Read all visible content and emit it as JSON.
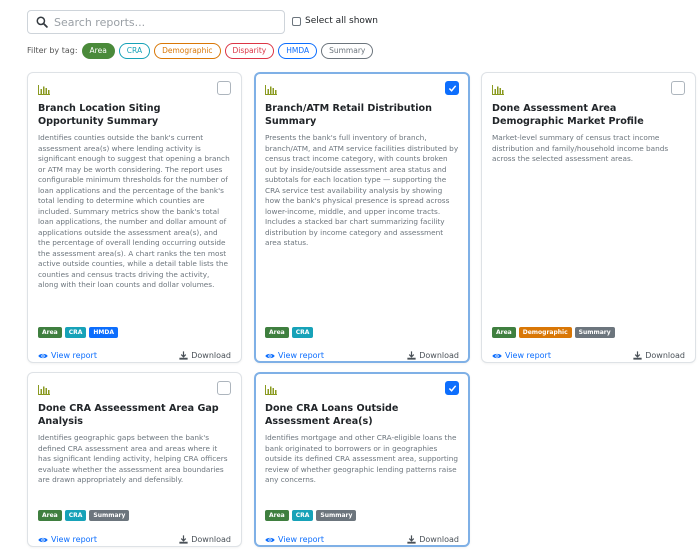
{
  "search": {
    "placeholder": "Search reports..."
  },
  "select_all_label": "Select all shown",
  "filter": {
    "label": "Filter by tag:",
    "tags": [
      {
        "label": "Area",
        "active": true,
        "color": "#4a8a3a"
      },
      {
        "label": "CRA",
        "active": false,
        "color": "#17a2b8"
      },
      {
        "label": "Demographic",
        "active": false,
        "color": "#d97706"
      },
      {
        "label": "Disparity",
        "active": false,
        "color": "#dc3545"
      },
      {
        "label": "HMDA",
        "active": false,
        "color": "#0d6efd"
      },
      {
        "label": "Summary",
        "active": false,
        "color": "#6c757d"
      }
    ]
  },
  "tag_colors": {
    "Area": "#3f7f3f",
    "CRA": "#17a2b8",
    "HMDA": "#0d6efd",
    "Demographic": "#d97706",
    "Summary": "#6c757d"
  },
  "cards": [
    {
      "title": "Branch Location Siting Opportunity Summary",
      "description": "Identifies counties outside the bank's current assessment area(s) where lending activity is significant enough to suggest that opening a branch or ATM may be worth considering. The report uses configurable minimum thresholds for the number of loan applications and the percentage of the bank's total lending to determine which counties are included. Summary metrics show the bank's total loan applications, the number and dollar amount of applications outside the assessment area(s), and the percentage of overall lending occurring outside the assessment area(s). A chart ranks the ten most active outside counties, while a detail table lists the counties and census tracts driving the activity, along with their loan counts and dollar volumes.",
      "tags": [
        "Area",
        "CRA",
        "HMDA"
      ],
      "checked": false,
      "view_label": "View report",
      "download_label": "Download"
    },
    {
      "title": "Branch/ATM Retail Distribution Summary",
      "description": "Presents the bank's full inventory of branch, branch/ATM, and ATM service facilities distributed by census tract income category, with counts broken out by inside/outside assessment area status and subtotals for each location type — supporting the CRA service test availability analysis by showing how the bank's physical presence is spread across lower-income, middle, and upper income tracts. Includes a stacked bar chart summarizing facility distribution by income category and assessment area status.",
      "tags": [
        "Area",
        "CRA"
      ],
      "checked": true,
      "view_label": "View report",
      "download_label": "Download"
    },
    {
      "title": "Done Assessment Area Demographic Market Profile",
      "description": "Market-level summary of census tract income distribution and family/household income bands across the selected assessment areas.",
      "tags": [
        "Area",
        "Demographic",
        "Summary"
      ],
      "checked": false,
      "view_label": "View report",
      "download_label": "Download"
    },
    {
      "title": "Done CRA Asseessment Area Gap Analysis",
      "description": "Identifies geographic gaps between the bank's defined CRA assessment area and areas where it has significant lending activity, helping CRA officers evaluate whether the assessment area boundaries are drawn appropriately and defensibly.",
      "tags": [
        "Area",
        "CRA",
        "Summary"
      ],
      "checked": false,
      "view_label": "View report",
      "download_label": "Download"
    },
    {
      "title": "Done CRA Loans Outside Assessment Area(s)",
      "description": "Identifies mortgage and other CRA-eligible loans the bank originated to borrowers or in geographies outside its defined CRA assessment area, supporting review of whether geographic lending patterns raise any concerns.",
      "tags": [
        "Area",
        "CRA",
        "Summary"
      ],
      "checked": true,
      "view_label": "View report",
      "download_label": "Download"
    }
  ]
}
